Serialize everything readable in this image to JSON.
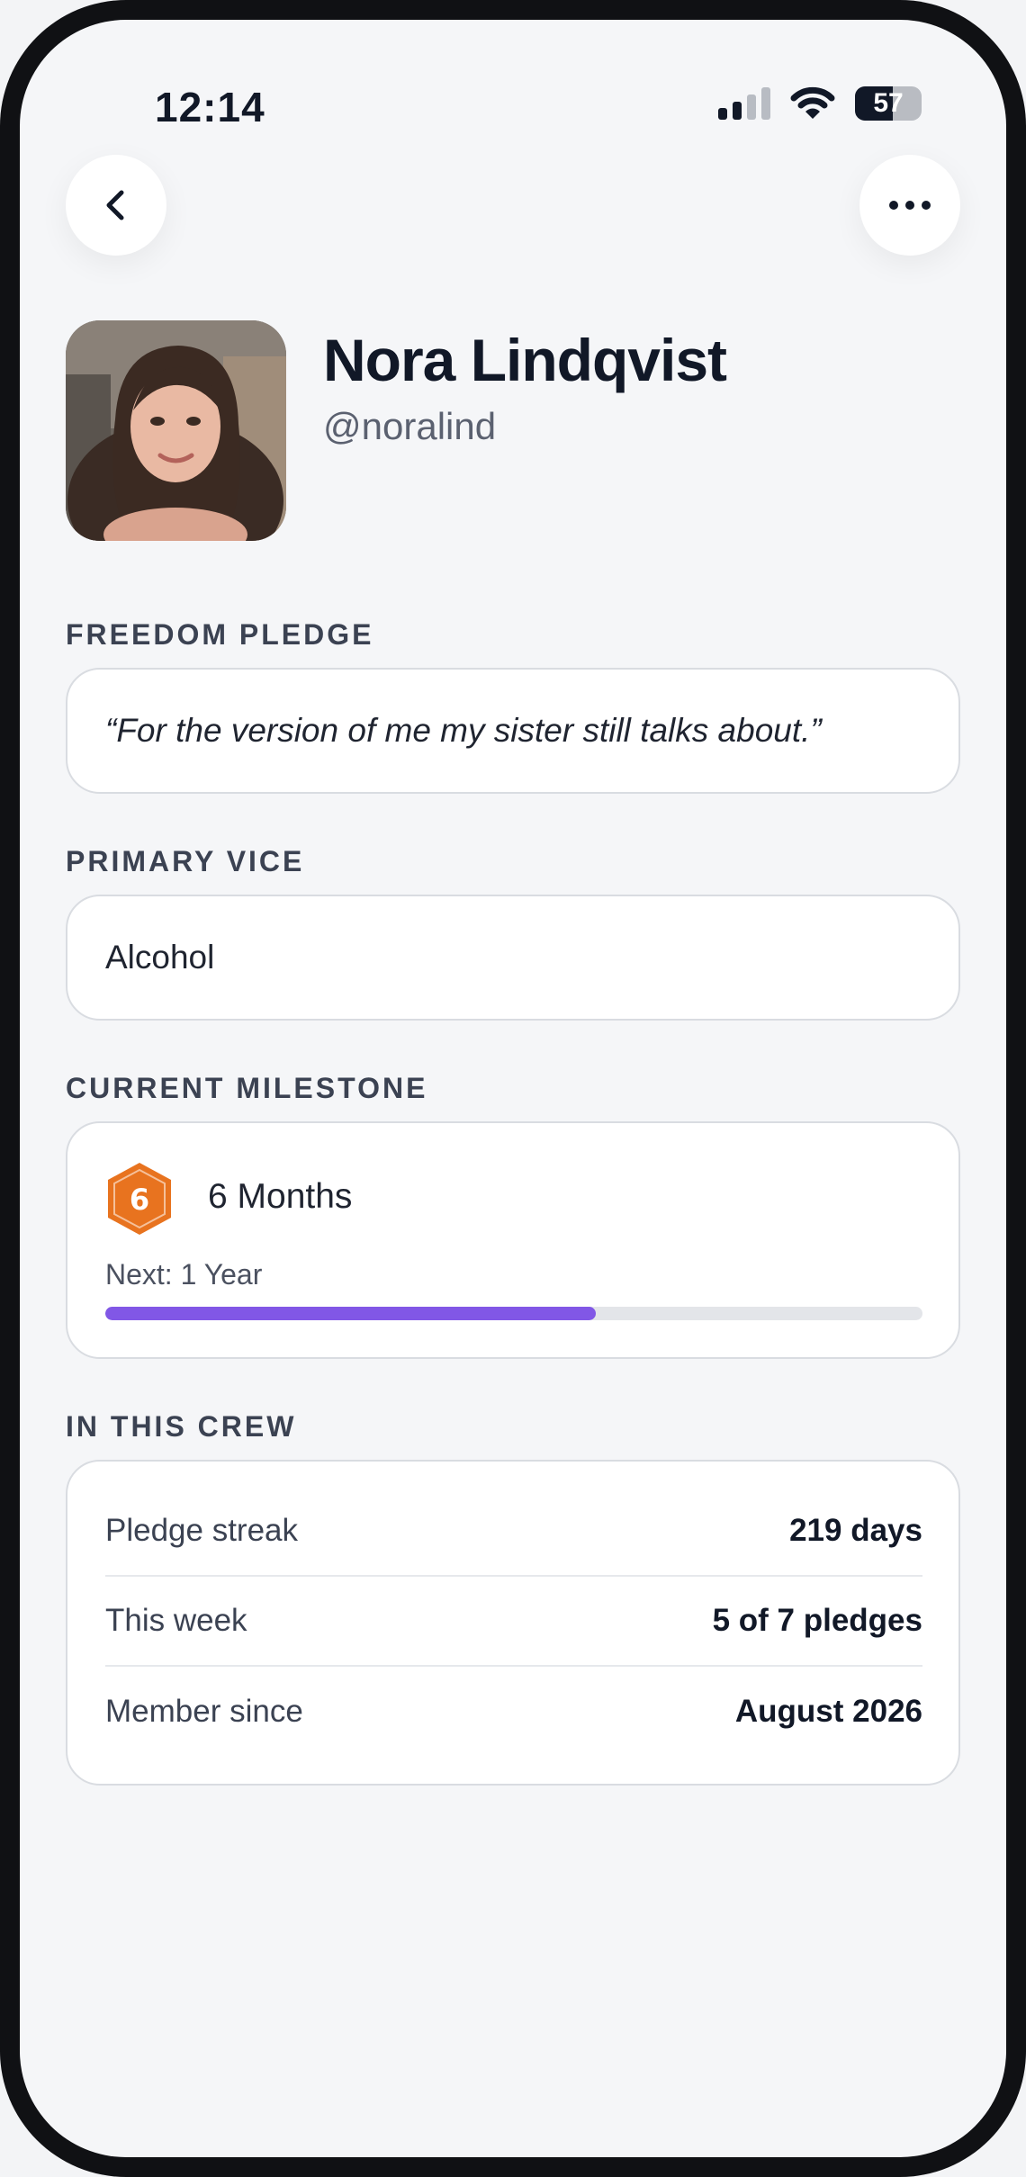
{
  "status_bar": {
    "time": "12:14",
    "battery_level": "57",
    "battery_fraction": 0.57
  },
  "nav": {
    "back_icon": "chevron-left-icon",
    "more_icon": "ellipsis-icon"
  },
  "profile": {
    "name": "Nora Lindqvist",
    "handle": "@noralind"
  },
  "freedom_pledge": {
    "label": "FREEDOM PLEDGE",
    "text": "“For the version of me my sister still talks about.”"
  },
  "primary_vice": {
    "label": "PRIMARY VICE",
    "value": "Alcohol"
  },
  "current_milestone": {
    "label": "CURRENT MILESTONE",
    "badge_number": "6",
    "badge_color": "#e8731f",
    "title": "6 Months",
    "next": "Next: 1 Year",
    "progress_fraction": 0.6,
    "progress_color": "#8157e6"
  },
  "crew": {
    "label": "IN THIS CREW",
    "stats": [
      {
        "label": "Pledge streak",
        "value": "219 days"
      },
      {
        "label": "This week",
        "value": "5 of 7 pledges"
      },
      {
        "label": "Member since",
        "value": "August 2026"
      }
    ]
  }
}
